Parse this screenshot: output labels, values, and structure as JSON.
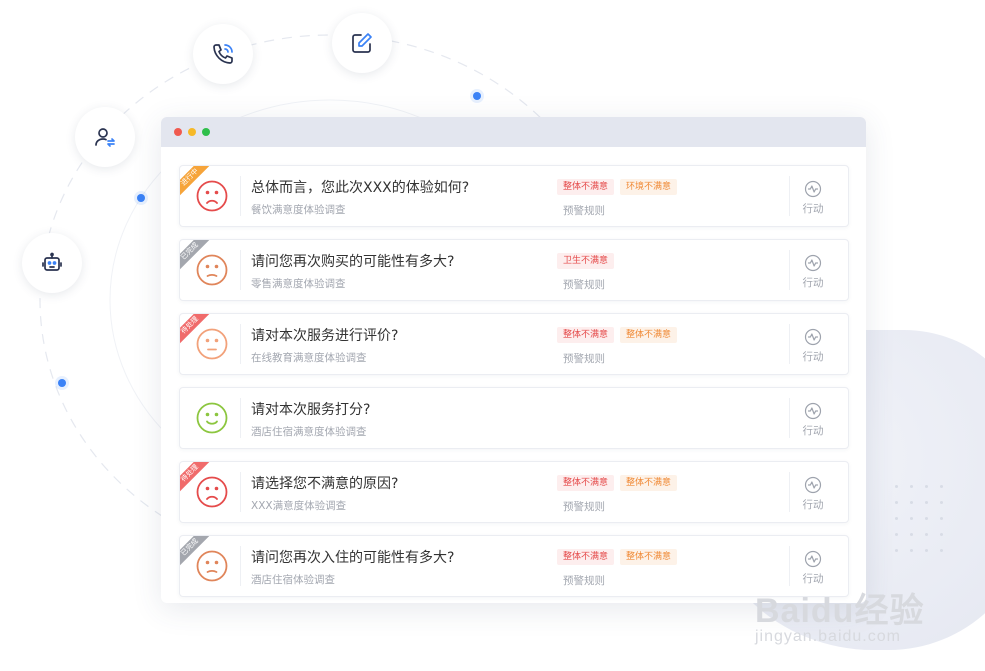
{
  "colors": {
    "red": "#e54b4b",
    "orange": "#f08a36",
    "peach": "#f2a17a",
    "green": "#8cc63f",
    "gray": "#9ea3ad",
    "blue": "#3b82f6"
  },
  "nodes": [
    {
      "icon": "user-transfer-icon"
    },
    {
      "icon": "phone-call-icon"
    },
    {
      "icon": "edit-icon"
    },
    {
      "icon": "robot-icon"
    }
  ],
  "surveys": [
    {
      "title": "总体而言，您此次XXX的体验如何?",
      "subtitle": "餐饮满意度体验调查",
      "status": "进行中",
      "status_color": "#f6a43a",
      "face": "sad",
      "face_color": "#e54b4b",
      "tags": [
        {
          "label": "整体不满意",
          "kind": "red"
        },
        {
          "label": "环境不满意",
          "kind": "orange"
        }
      ],
      "rule": "预警规则",
      "action": "行动"
    },
    {
      "title": "请问您再次购买的可能性有多大?",
      "subtitle": "零售满意度体验调查",
      "status": "已完成",
      "status_color": "#a4a7ae",
      "face": "meh",
      "face_color": "#e0855a",
      "tags": [
        {
          "label": "卫生不满意",
          "kind": "red"
        }
      ],
      "rule": "预警规则",
      "action": "行动"
    },
    {
      "title": "请对本次服务进行评价?",
      "subtitle": "在线教育满意度体验调查",
      "status": "待处理",
      "status_color": "#f06b6b",
      "face": "neutral",
      "face_color": "#f2a17a",
      "tags": [
        {
          "label": "整体不满意",
          "kind": "red"
        },
        {
          "label": "整体不满意",
          "kind": "orange"
        }
      ],
      "rule": "预警规则",
      "action": "行动"
    },
    {
      "title": "请对本次服务打分?",
      "subtitle": "酒店住宿满意度体验调查",
      "status": "",
      "status_color": "",
      "face": "happy",
      "face_color": "#8cc63f",
      "tags": [],
      "rule": "",
      "action": "行动"
    },
    {
      "title": "请选择您不满意的原因?",
      "subtitle": "XXX满意度体验调查",
      "status": "待处理",
      "status_color": "#f06b6b",
      "face": "sad",
      "face_color": "#e54b4b",
      "tags": [
        {
          "label": "整体不满意",
          "kind": "red"
        },
        {
          "label": "整体不满意",
          "kind": "orange"
        }
      ],
      "rule": "预警规则",
      "action": "行动"
    },
    {
      "title": "请问您再次入住的可能性有多大?",
      "subtitle": "酒店住宿体验调查",
      "status": "已完成",
      "status_color": "#a4a7ae",
      "face": "meh",
      "face_color": "#e0855a",
      "tags": [
        {
          "label": "整体不满意",
          "kind": "red"
        },
        {
          "label": "整体不满意",
          "kind": "orange"
        }
      ],
      "rule": "预警规则",
      "action": "行动"
    }
  ],
  "watermark": {
    "main": "Baidu经验",
    "sub": "jingyan.baidu.com"
  }
}
